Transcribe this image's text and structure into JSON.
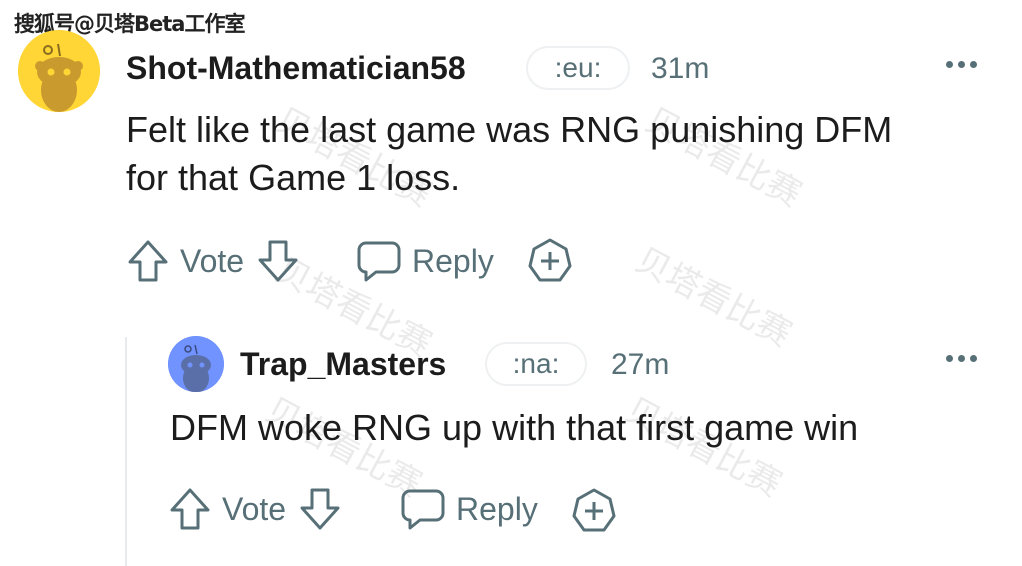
{
  "watermark": {
    "brand": "搜狐号@贝塔Beta工作室",
    "overlay": "贝塔看比赛"
  },
  "comments": [
    {
      "username": "Shot-Mathematician58",
      "flair": ":eu:",
      "time": "31m",
      "body_lines": [
        "Felt like the last game was RNG punishing DFM",
        "for that Game 1 loss."
      ],
      "vote_label": "Vote",
      "reply_label": "Reply",
      "avatar_color": "#ffd635"
    },
    {
      "username": "Trap_Masters",
      "flair": ":na:",
      "time": "27m",
      "body_lines": [
        "DFM woke RNG up with that first game win"
      ],
      "vote_label": "Vote",
      "reply_label": "Reply",
      "avatar_color": "#7193ff"
    }
  ],
  "colors": {
    "text": "#1c1c1c",
    "meta": "#576f76",
    "thread_line": "#e5ebee"
  },
  "icons": [
    "upvote-icon",
    "downvote-icon",
    "comment-icon",
    "award-icon",
    "more-options-icon",
    "snoo-avatar-icon"
  ]
}
